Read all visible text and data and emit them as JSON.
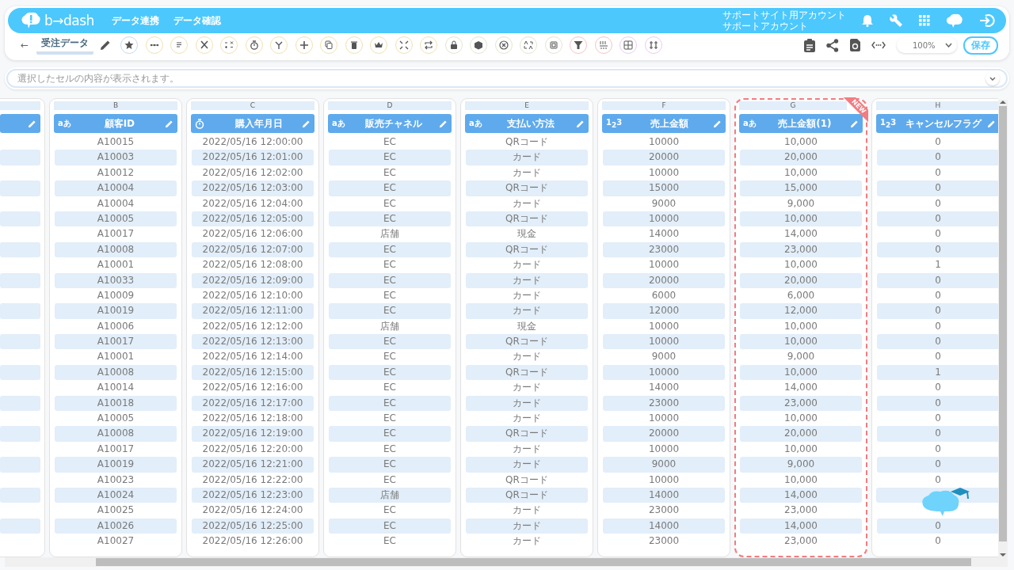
{
  "header": {
    "logo_text": "b→dash",
    "nav": [
      {
        "label": "データ連携"
      },
      {
        "label": "データ確認"
      }
    ],
    "account": {
      "site": "サポートサイト用アカウント",
      "name": "サポートアカウント"
    }
  },
  "toolbar": {
    "back": "←",
    "sheet_title": "受注データ",
    "tools": [
      {
        "color": "#c6daf0"
      },
      {
        "color": "#f3e1b2"
      },
      {
        "color": "#f3e1b2"
      },
      {
        "color": "#f3e1b2"
      },
      {
        "color": "#f3e1b2"
      },
      {
        "color": "#f3e1b2"
      },
      {
        "color": "#f3e1b2"
      },
      {
        "color": "#f3e1b2"
      },
      {
        "color": "#f3e1b2"
      },
      {
        "color": "#f3e1b2"
      },
      {
        "color": "#f3e1b2"
      },
      {
        "color": "#f3e1b2"
      },
      {
        "color": "#f3e1b2"
      },
      {
        "color": "#e3e6cc"
      },
      {
        "color": "#e3e6cc"
      },
      {
        "color": "#e3e6cc"
      },
      {
        "color": "#e3e6cc"
      },
      {
        "color": "#e3e6cc"
      },
      {
        "color": "#f7c4c4"
      },
      {
        "color": "#f7c4c4"
      },
      {
        "color": "#eccbf3"
      },
      {
        "color": "#eccbf3"
      }
    ],
    "zoom": "100%",
    "save": "保存"
  },
  "formula_bar": {
    "placeholder": "選択したセルの内容が表示されます。"
  },
  "table": {
    "left_column_cut": true,
    "columns": [
      {
        "letter": "B",
        "name": "顧客ID",
        "kind": "label",
        "type_label": "aあ",
        "new": false
      },
      {
        "letter": "C",
        "name": "購入年月日",
        "kind": "stopwatch",
        "new": false
      },
      {
        "letter": "D",
        "name": "販売チャネル",
        "kind": "label",
        "type_label": "aあ",
        "new": false
      },
      {
        "letter": "E",
        "name": "支払い方法",
        "kind": "label",
        "type_label": "aあ",
        "new": false
      },
      {
        "letter": "F",
        "name": "売上金額",
        "kind": "label",
        "type_label": "1$_{2}$3",
        "new": false
      },
      {
        "letter": "G",
        "name": "売上金額(1)",
        "kind": "label",
        "type_label": "aあ",
        "new": true,
        "badge": "NEW"
      },
      {
        "letter": "H",
        "name": "キャンセルフラグ",
        "kind": "label",
        "type_label": "1$_{2}$3",
        "new": false
      }
    ],
    "rows": [
      [
        "A10015",
        "2022/05/16 12:00:00",
        "EC",
        "QRコード",
        "10000",
        "10,000",
        "0"
      ],
      [
        "A10003",
        "2022/05/16 12:01:00",
        "EC",
        "カード",
        "20000",
        "20,000",
        "0"
      ],
      [
        "A10012",
        "2022/05/16 12:02:00",
        "EC",
        "カード",
        "10000",
        "10,000",
        "0"
      ],
      [
        "A10004",
        "2022/05/16 12:03:00",
        "EC",
        "QRコード",
        "15000",
        "15,000",
        "0"
      ],
      [
        "A10004",
        "2022/05/16 12:04:00",
        "EC",
        "カード",
        "9000",
        "9,000",
        "0"
      ],
      [
        "A10005",
        "2022/05/16 12:05:00",
        "EC",
        "QRコード",
        "10000",
        "10,000",
        "0"
      ],
      [
        "A10017",
        "2022/05/16 12:06:00",
        "店舗",
        "現金",
        "14000",
        "14,000",
        "0"
      ],
      [
        "A10008",
        "2022/05/16 12:07:00",
        "EC",
        "QRコード",
        "23000",
        "23,000",
        "0"
      ],
      [
        "A10001",
        "2022/05/16 12:08:00",
        "EC",
        "カード",
        "10000",
        "10,000",
        "1"
      ],
      [
        "A10033",
        "2022/05/16 12:09:00",
        "EC",
        "カード",
        "20000",
        "20,000",
        "0"
      ],
      [
        "A10009",
        "2022/05/16 12:10:00",
        "EC",
        "カード",
        "6000",
        "6,000",
        "0"
      ],
      [
        "A10019",
        "2022/05/16 12:11:00",
        "EC",
        "カード",
        "12000",
        "12,000",
        "0"
      ],
      [
        "A10006",
        "2022/05/16 12:12:00",
        "店舗",
        "現金",
        "10000",
        "10,000",
        "0"
      ],
      [
        "A10017",
        "2022/05/16 12:13:00",
        "EC",
        "QRコード",
        "10000",
        "10,000",
        "0"
      ],
      [
        "A10001",
        "2022/05/16 12:14:00",
        "EC",
        "カード",
        "9000",
        "9,000",
        "0"
      ],
      [
        "A10008",
        "2022/05/16 12:15:00",
        "EC",
        "QRコード",
        "10000",
        "10,000",
        "1"
      ],
      [
        "A10014",
        "2022/05/16 12:16:00",
        "EC",
        "カード",
        "14000",
        "14,000",
        "0"
      ],
      [
        "A10018",
        "2022/05/16 12:17:00",
        "EC",
        "カード",
        "23000",
        "23,000",
        "0"
      ],
      [
        "A10005",
        "2022/05/16 12:18:00",
        "EC",
        "カード",
        "10000",
        "10,000",
        "0"
      ],
      [
        "A10008",
        "2022/05/16 12:19:00",
        "EC",
        "QRコード",
        "20000",
        "20,000",
        "0"
      ],
      [
        "A10017",
        "2022/05/16 12:20:00",
        "EC",
        "カード",
        "10000",
        "10,000",
        "0"
      ],
      [
        "A10019",
        "2022/05/16 12:21:00",
        "EC",
        "カード",
        "9000",
        "9,000",
        "0"
      ],
      [
        "A10023",
        "2022/05/16 12:22:00",
        "EC",
        "QRコード",
        "10000",
        "10,000",
        "0"
      ],
      [
        "A10024",
        "2022/05/16 12:23:00",
        "店舗",
        "QRコード",
        "14000",
        "14,000",
        null
      ],
      [
        "A10025",
        "2022/05/16 12:24:00",
        "EC",
        "カード",
        "23000",
        "23,000",
        null
      ],
      [
        "A10026",
        "2022/05/16 12:25:00",
        "EC",
        "カード",
        "14000",
        "14,000",
        "0"
      ],
      [
        "A10027",
        "2022/05/16 12:26:00",
        "EC",
        "カード",
        "23000",
        "23,000",
        "0"
      ]
    ]
  }
}
